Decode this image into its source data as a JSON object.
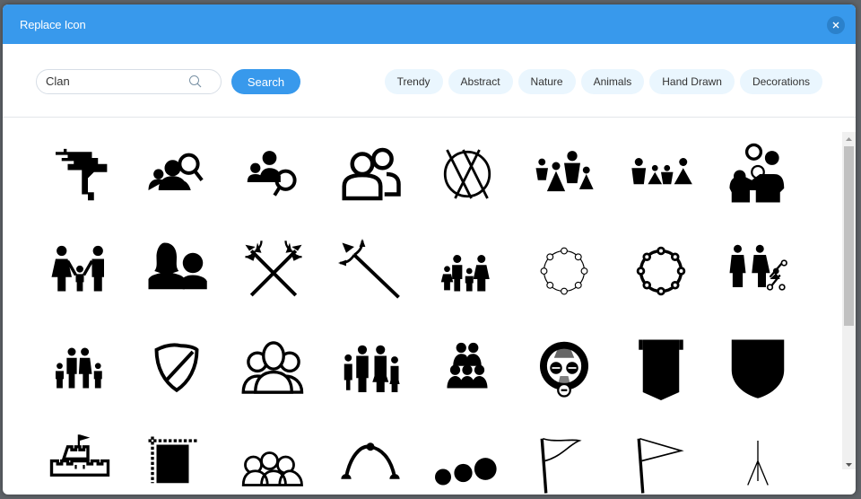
{
  "dialog": {
    "title": "Replace Icon",
    "close_icon": "close-icon"
  },
  "search": {
    "value": "Clan",
    "placeholder": "",
    "icon": "search-icon",
    "button_label": "Search"
  },
  "categories": [
    "Trendy",
    "Abstract",
    "Nature",
    "Animals",
    "Hand Drawn",
    "Decorations"
  ],
  "colors": {
    "accent": "#3899ec",
    "category_bg": "#eaf6fe",
    "close_bg": "#2b81cb"
  },
  "icons": [
    [
      "uzi-guns-icon",
      "people-search-icon",
      "group-search-icon",
      "two-users-outline-icon"
    ],
    [
      "circle-cross-lines-icon",
      "family-four-members-icon",
      "family-small-figures-icon",
      "family-hug-icon"
    ],
    [
      "family-holding-hands-icon",
      "woman-man-silhouette-icon",
      "crossed-tridents-icon",
      "trident-icon"
    ],
    [
      "family-four-small-icon",
      "circle-nodes-thin-icon",
      "circle-nodes-bold-icon",
      "couple-stroller-icon"
    ],
    [
      "family-kids-hands-icon",
      "shield-slash-icon",
      "group-outline-icon",
      "family-four-standing-icon"
    ],
    [
      "group-pyramid-icon",
      "tribal-mask-icon",
      "banner-pennant-icon",
      "shield-solid-icon"
    ],
    [
      "castle-flag-icon",
      "tapestry-banner-icon",
      "group-circles-outline-icon",
      "arc-nodes-icon"
    ],
    [
      "three-dots-growing-icon",
      "wavy-flag-icon",
      "triangle-flag-icon",
      "tripod-icon"
    ]
  ]
}
